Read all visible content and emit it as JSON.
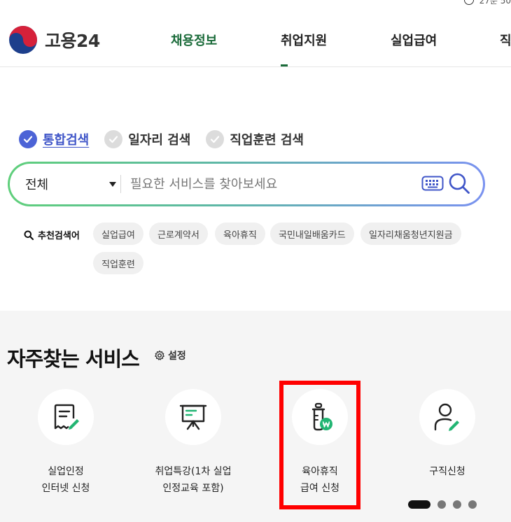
{
  "header": {
    "logo_text": "고용24",
    "top_util_text": "27분 50",
    "nav": [
      {
        "label": "채용정보",
        "active": true
      },
      {
        "label": "취업지원",
        "active": false
      },
      {
        "label": "실업급여",
        "active": false
      },
      {
        "label": "직",
        "active": false
      }
    ]
  },
  "search": {
    "tabs": [
      {
        "label": "통합검색",
        "selected": true
      },
      {
        "label": "일자리 검색",
        "selected": false
      },
      {
        "label": "직업훈련 검색",
        "selected": false
      }
    ],
    "select_value": "전체",
    "placeholder": "필요한 서비스를 찾아보세요",
    "recommended_label": "추천검색어",
    "recommended": [
      "실업급여",
      "근로계약서",
      "육아휴직",
      "국민내일배움카드",
      "일자리채움청년지원금",
      "직업훈련"
    ]
  },
  "services": {
    "title": "자주찾는 서비스",
    "setting_label": "설정",
    "items": [
      {
        "line1": "실업인정",
        "line2": "인터넷 신청",
        "icon": "receipt-pen-icon"
      },
      {
        "line1": "취업특강(1차 실업",
        "line2": "인정교육 포함)",
        "icon": "presentation-board-icon"
      },
      {
        "line1": "육아휴직",
        "line2": "급여 신청",
        "icon": "baby-bottle-won-icon"
      },
      {
        "line1": "구직신청",
        "line2": "",
        "icon": "person-pen-icon"
      }
    ],
    "pager": {
      "pages": 4,
      "current": 1
    }
  },
  "colors": {
    "nav_active": "#1b6b3a",
    "tab_active": "#4c63d6",
    "icon_green": "#22b573",
    "highlight": "#ff0000"
  }
}
